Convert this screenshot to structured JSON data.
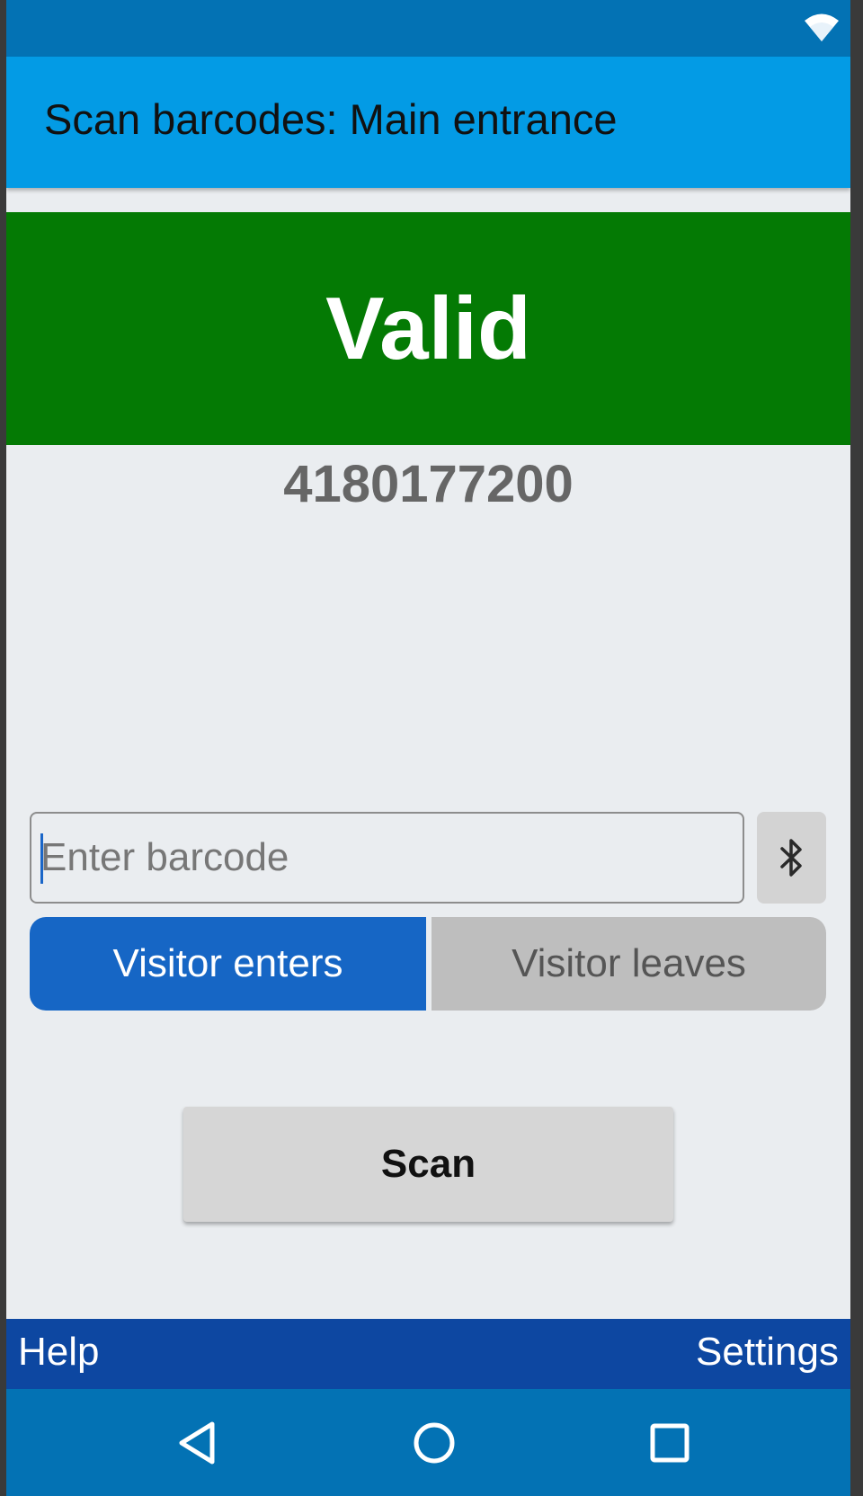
{
  "app": {
    "title": "Scan barcodes: Main entrance"
  },
  "status_bar": {
    "icons": [
      "wifi-icon"
    ]
  },
  "result": {
    "status": "Valid",
    "status_color": "#047a04",
    "barcode": "4180177200"
  },
  "input": {
    "placeholder": "Enter barcode",
    "value": "",
    "side_button_icon": "bluetooth-icon"
  },
  "direction_toggle": {
    "options": [
      "Visitor enters",
      "Visitor leaves"
    ],
    "selected": "Visitor enters"
  },
  "scan_button": {
    "label": "Scan"
  },
  "bottom_bar": {
    "help_label": "Help",
    "settings_label": "Settings"
  },
  "nav_bar": {
    "icons": [
      "back-icon",
      "home-icon",
      "recents-icon"
    ]
  },
  "colors": {
    "status_bar": "#0372b4",
    "app_bar": "#039be5",
    "selected_segment": "#1666c5",
    "bottom_bar": "#0d47a1"
  }
}
